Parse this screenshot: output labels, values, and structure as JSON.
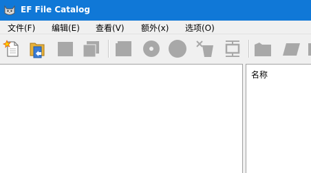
{
  "window": {
    "title": "EF File Catalog",
    "title_bar_color": "#1078d7"
  },
  "menu": [
    {
      "label": "文件(F)"
    },
    {
      "label": "编辑(E)"
    },
    {
      "label": "查看(V)"
    },
    {
      "label": "额外(x)"
    },
    {
      "label": "选项(O)"
    }
  ],
  "toolbar": {
    "buttons": [
      {
        "icon": "new-catalog-icon",
        "enabled": true
      },
      {
        "icon": "open-catalog-icon",
        "enabled": true
      },
      {
        "icon": "square-icon",
        "enabled": false
      },
      {
        "icon": "stacked-squares-icon",
        "enabled": false
      },
      {
        "icon": "stacked-squares-icon",
        "enabled": false
      },
      {
        "icon": "disc-icon",
        "enabled": false
      },
      {
        "icon": "circle-icon",
        "enabled": false
      },
      {
        "icon": "cup-icon",
        "enabled": false
      },
      {
        "icon": "monitor-icon",
        "enabled": false
      },
      {
        "icon": "folder-icon",
        "enabled": false
      },
      {
        "icon": "tag-icon",
        "enabled": false
      }
    ]
  },
  "right_pane": {
    "column_header": "名称"
  }
}
